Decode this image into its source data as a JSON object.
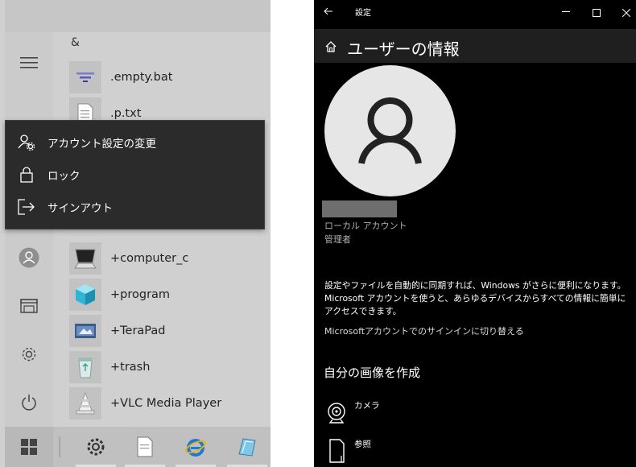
{
  "start_menu": {
    "section_letter": "&",
    "apps": [
      {
        "label": ".empty.bat",
        "icon": "batch-file-icon"
      },
      {
        "label": ".p.txt",
        "icon": "text-file-icon"
      },
      {
        "label": "+computer_c",
        "icon": "computer-icon"
      },
      {
        "label": "+program",
        "icon": "cube-icon"
      },
      {
        "label": "+TeraPad",
        "icon": "terapad-icon"
      },
      {
        "label": "+trash",
        "icon": "recycle-bin-icon"
      },
      {
        "label": "+VLC Media Player",
        "icon": "vlc-cone-icon"
      }
    ],
    "context_menu": {
      "change_account_settings": "アカウント設定の変更",
      "lock": "ロック",
      "sign_out": "サインアウト"
    }
  },
  "settings": {
    "window_title": "設定",
    "page_title": "ユーザーの情報",
    "account_type": "ローカル アカウント",
    "role": "管理者",
    "sync_paragraph_1": "設定やファイルを自動的に同期すれば、Windows がさらに便利になります。",
    "sync_paragraph_2": "Microsoft アカウントを使うと、あらゆるデバイスからすべての情報に簡単にアクセスできます。",
    "switch_link": "Microsoftアカウントでのサインインに切り替える",
    "create_picture_heading": "自分の画像を作成",
    "camera_label": "カメラ",
    "browse_label": "参照"
  },
  "colors": {
    "settings_bg": "#000000",
    "header_bg": "#1f1f1f",
    "context_menu_bg": "#2b2b2b",
    "start_bg": "#d0d0d0"
  }
}
